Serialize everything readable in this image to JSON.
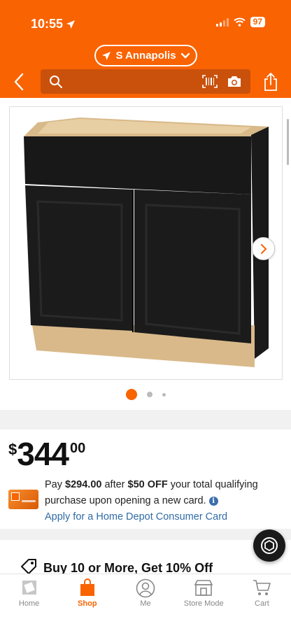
{
  "status_bar": {
    "time": "10:55",
    "battery": "97"
  },
  "header": {
    "location": "S Annapolis",
    "search_placeholder": "",
    "icons": [
      "back-icon",
      "search-icon",
      "barcode-scan-icon",
      "camera-icon",
      "share-icon"
    ]
  },
  "colors": {
    "brand": "#f96302",
    "link": "#2f6ba6",
    "search_bg": "#c9510c"
  },
  "gallery": {
    "current_index": 1,
    "total_dots": 3
  },
  "price": {
    "currency": "$",
    "dollars": "344",
    "cents": "00"
  },
  "promo": {
    "line_pay": "Pay",
    "discounted_price": "$294.00",
    "after": "after",
    "discount": "$50 OFF",
    "rest": "your total qualifying purchase upon opening a new card.",
    "apply_link": "Apply for a Home Depot Consumer Card"
  },
  "bulk": {
    "text": "Buy 10 or More, Get 10% Off"
  },
  "tabs": [
    {
      "label": "Home",
      "icon": "home-depot-logo-icon",
      "active": false
    },
    {
      "label": "Shop",
      "icon": "shop-bag-icon",
      "active": true
    },
    {
      "label": "Me",
      "icon": "person-icon",
      "active": false
    },
    {
      "label": "Store Mode",
      "icon": "store-icon",
      "active": false
    },
    {
      "label": "Cart",
      "icon": "cart-icon",
      "active": false
    }
  ]
}
